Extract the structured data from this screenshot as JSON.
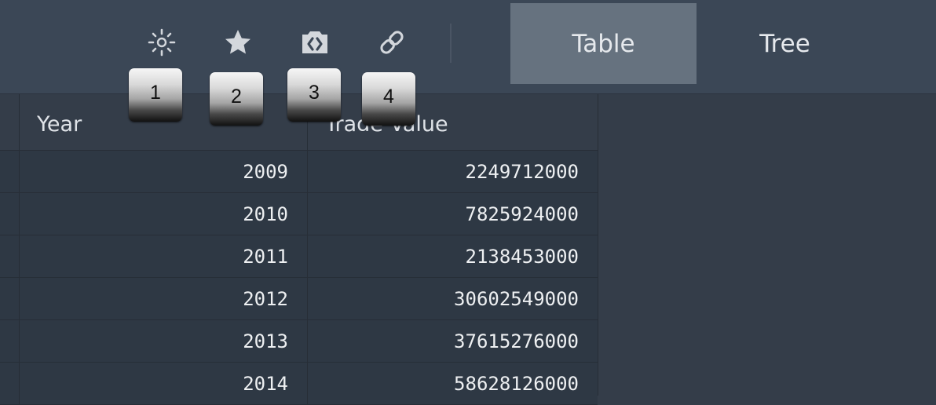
{
  "toolbar": {
    "icons": [
      {
        "name": "brightness-icon"
      },
      {
        "name": "star-icon"
      },
      {
        "name": "embed-code-icon"
      },
      {
        "name": "link-icon"
      }
    ],
    "tabs": [
      {
        "label": "Table",
        "active": true
      },
      {
        "label": "Tree",
        "active": false
      }
    ]
  },
  "badges": [
    "1",
    "2",
    "3",
    "4"
  ],
  "table": {
    "columns": [
      "Year",
      "Trade Value"
    ],
    "rows": [
      {
        "year": "2009",
        "value": "2249712000"
      },
      {
        "year": "2010",
        "value": "7825924000"
      },
      {
        "year": "2011",
        "value": "2138453000"
      },
      {
        "year": "2012",
        "value": "30602549000"
      },
      {
        "year": "2013",
        "value": "37615276000"
      },
      {
        "year": "2014",
        "value": "58628126000"
      }
    ]
  },
  "colors": {
    "toolbar_bg": "#3b4756",
    "active_tab_bg": "#66727f",
    "page_bg": "#343d49",
    "row_bg": "#2e3844"
  }
}
